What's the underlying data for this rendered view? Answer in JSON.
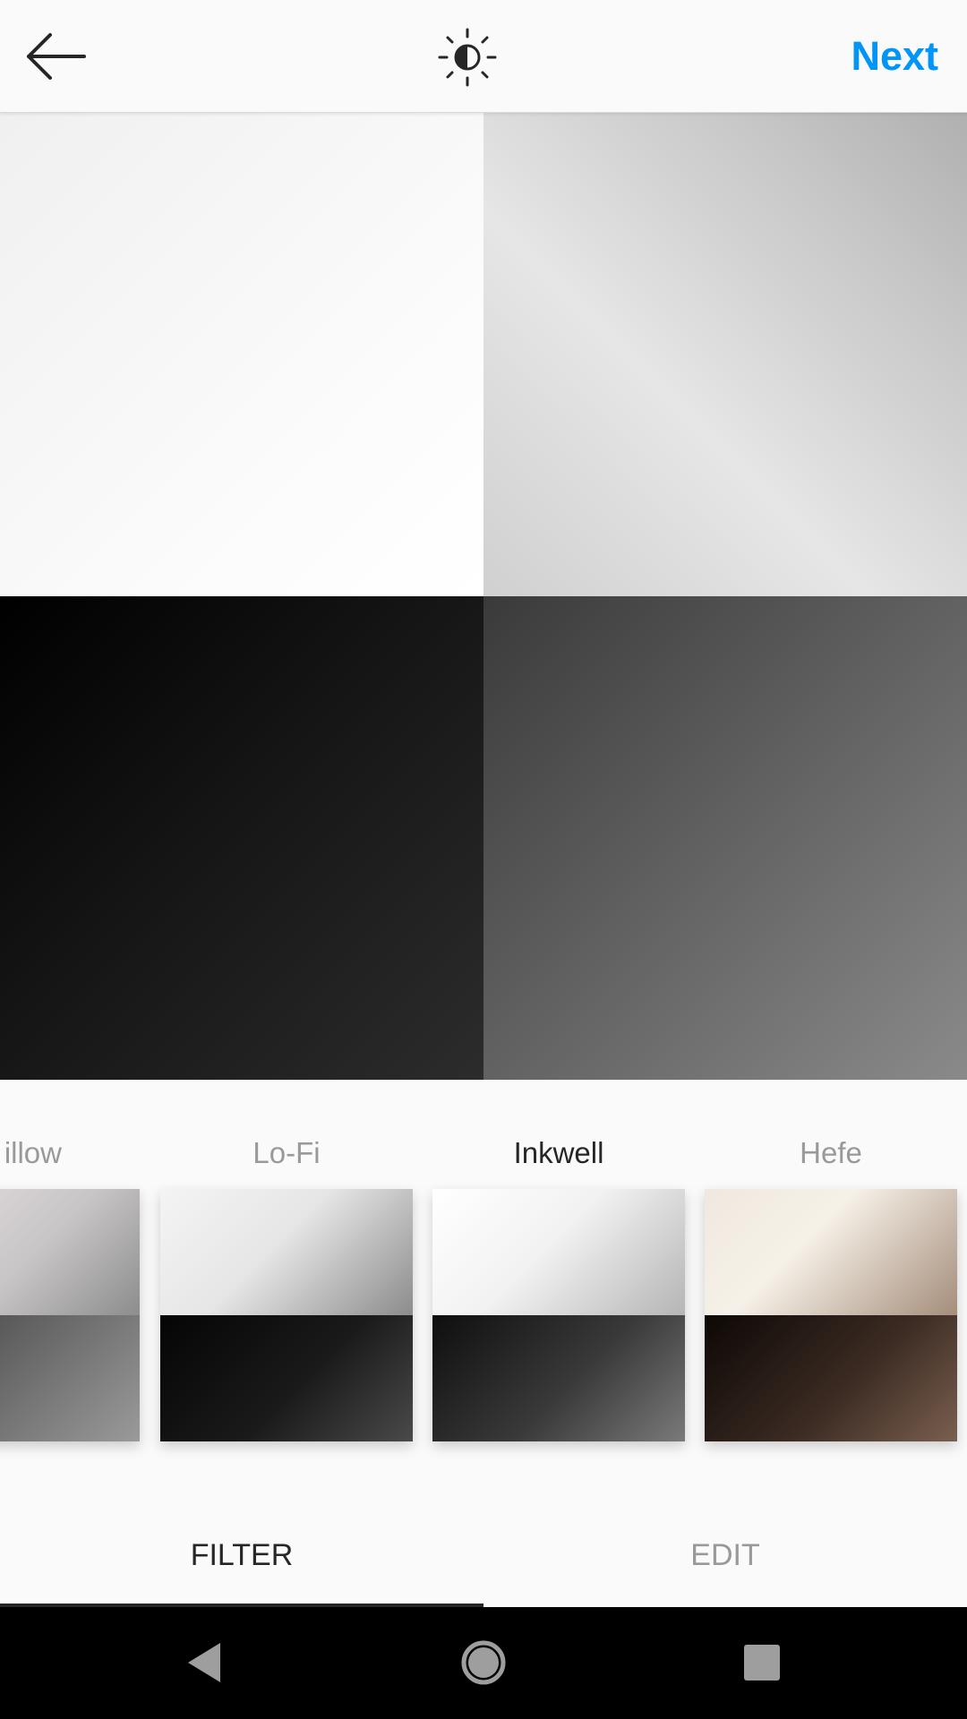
{
  "header": {
    "back_icon": "arrow-left-icon",
    "lux_icon": "brightness-contrast-icon",
    "next_label": "Next",
    "accent_color": "#0095f6"
  },
  "filters": {
    "items": [
      {
        "label": "Willow",
        "visible_label": "illow",
        "selected": false
      },
      {
        "label": "Lo-Fi",
        "visible_label": "Lo-Fi",
        "selected": false
      },
      {
        "label": "Inkwell",
        "visible_label": "Inkwell",
        "selected": true
      },
      {
        "label": "Hefe",
        "visible_label": "Hefe",
        "selected": false
      }
    ]
  },
  "tabs": {
    "items": [
      {
        "label": "FILTER",
        "active": true
      },
      {
        "label": "EDIT",
        "active": false
      }
    ]
  },
  "system_nav": {
    "back_icon": "nav-back-triangle-icon",
    "home_icon": "nav-home-circle-icon",
    "recents_icon": "nav-recents-square-icon"
  }
}
